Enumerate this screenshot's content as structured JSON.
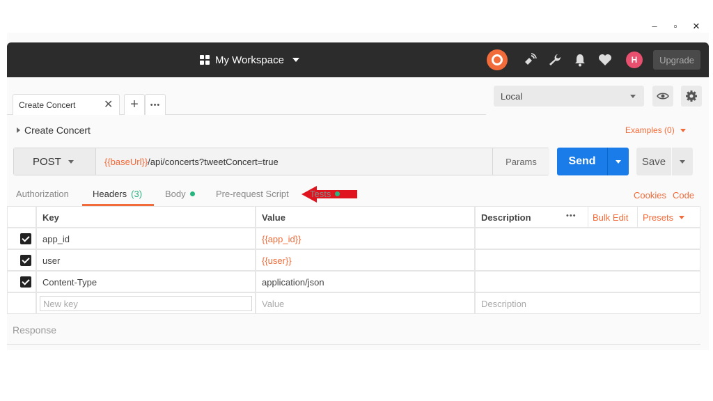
{
  "window_controls": {
    "minimize": "–",
    "maximize": "▫",
    "close": "✕"
  },
  "header": {
    "workspace_label": "My Workspace",
    "avatar_initials": "H",
    "upgrade_label": "Upgrade"
  },
  "tabs": {
    "active_tab_label": "Create Concert",
    "close_glyph": "✕",
    "add_glyph": "+",
    "more_glyph": "•••"
  },
  "environment": {
    "selected": "Local"
  },
  "request": {
    "name": "Create Concert",
    "examples_label": "Examples (0)",
    "method": "POST",
    "url_var": "{{baseUrl}}",
    "url_rest": "/api/concerts?tweetConcert=true",
    "params_label": "Params",
    "send_label": "Send",
    "save_label": "Save"
  },
  "subtabs": {
    "authorization": "Authorization",
    "headers": "Headers",
    "headers_count": "(3)",
    "body": "Body",
    "prerequest": "Pre-request Script",
    "tests": "Tests",
    "cookies": "Cookies",
    "code": "Code"
  },
  "headers_table": {
    "col_key": "Key",
    "col_value": "Value",
    "col_description": "Description",
    "more_glyph": "•••",
    "bulk_edit": "Bulk Edit",
    "presets": "Presets",
    "rows": [
      {
        "key": "app_id",
        "value": "{{app_id}}",
        "checked": true
      },
      {
        "key": "user",
        "value": "{{user}}",
        "checked": true
      },
      {
        "key": "Content-Type",
        "value": "application/json",
        "checked": true
      }
    ],
    "placeholder_key": "New key",
    "placeholder_value": "Value",
    "placeholder_description": "Description"
  },
  "response": {
    "label": "Response"
  },
  "colors": {
    "accent": "#f26b3a",
    "send_blue": "#1a7ce8",
    "header_bg": "#2c2c2c",
    "status_green": "#26b47f",
    "annotation_arrow": "#e0141e"
  },
  "icons": [
    "grid-icon",
    "sync-icon",
    "satellite-icon",
    "wrench-icon",
    "bell-icon",
    "heart-icon",
    "eye-icon",
    "gear-icon",
    "red-arrow-annotation"
  ]
}
